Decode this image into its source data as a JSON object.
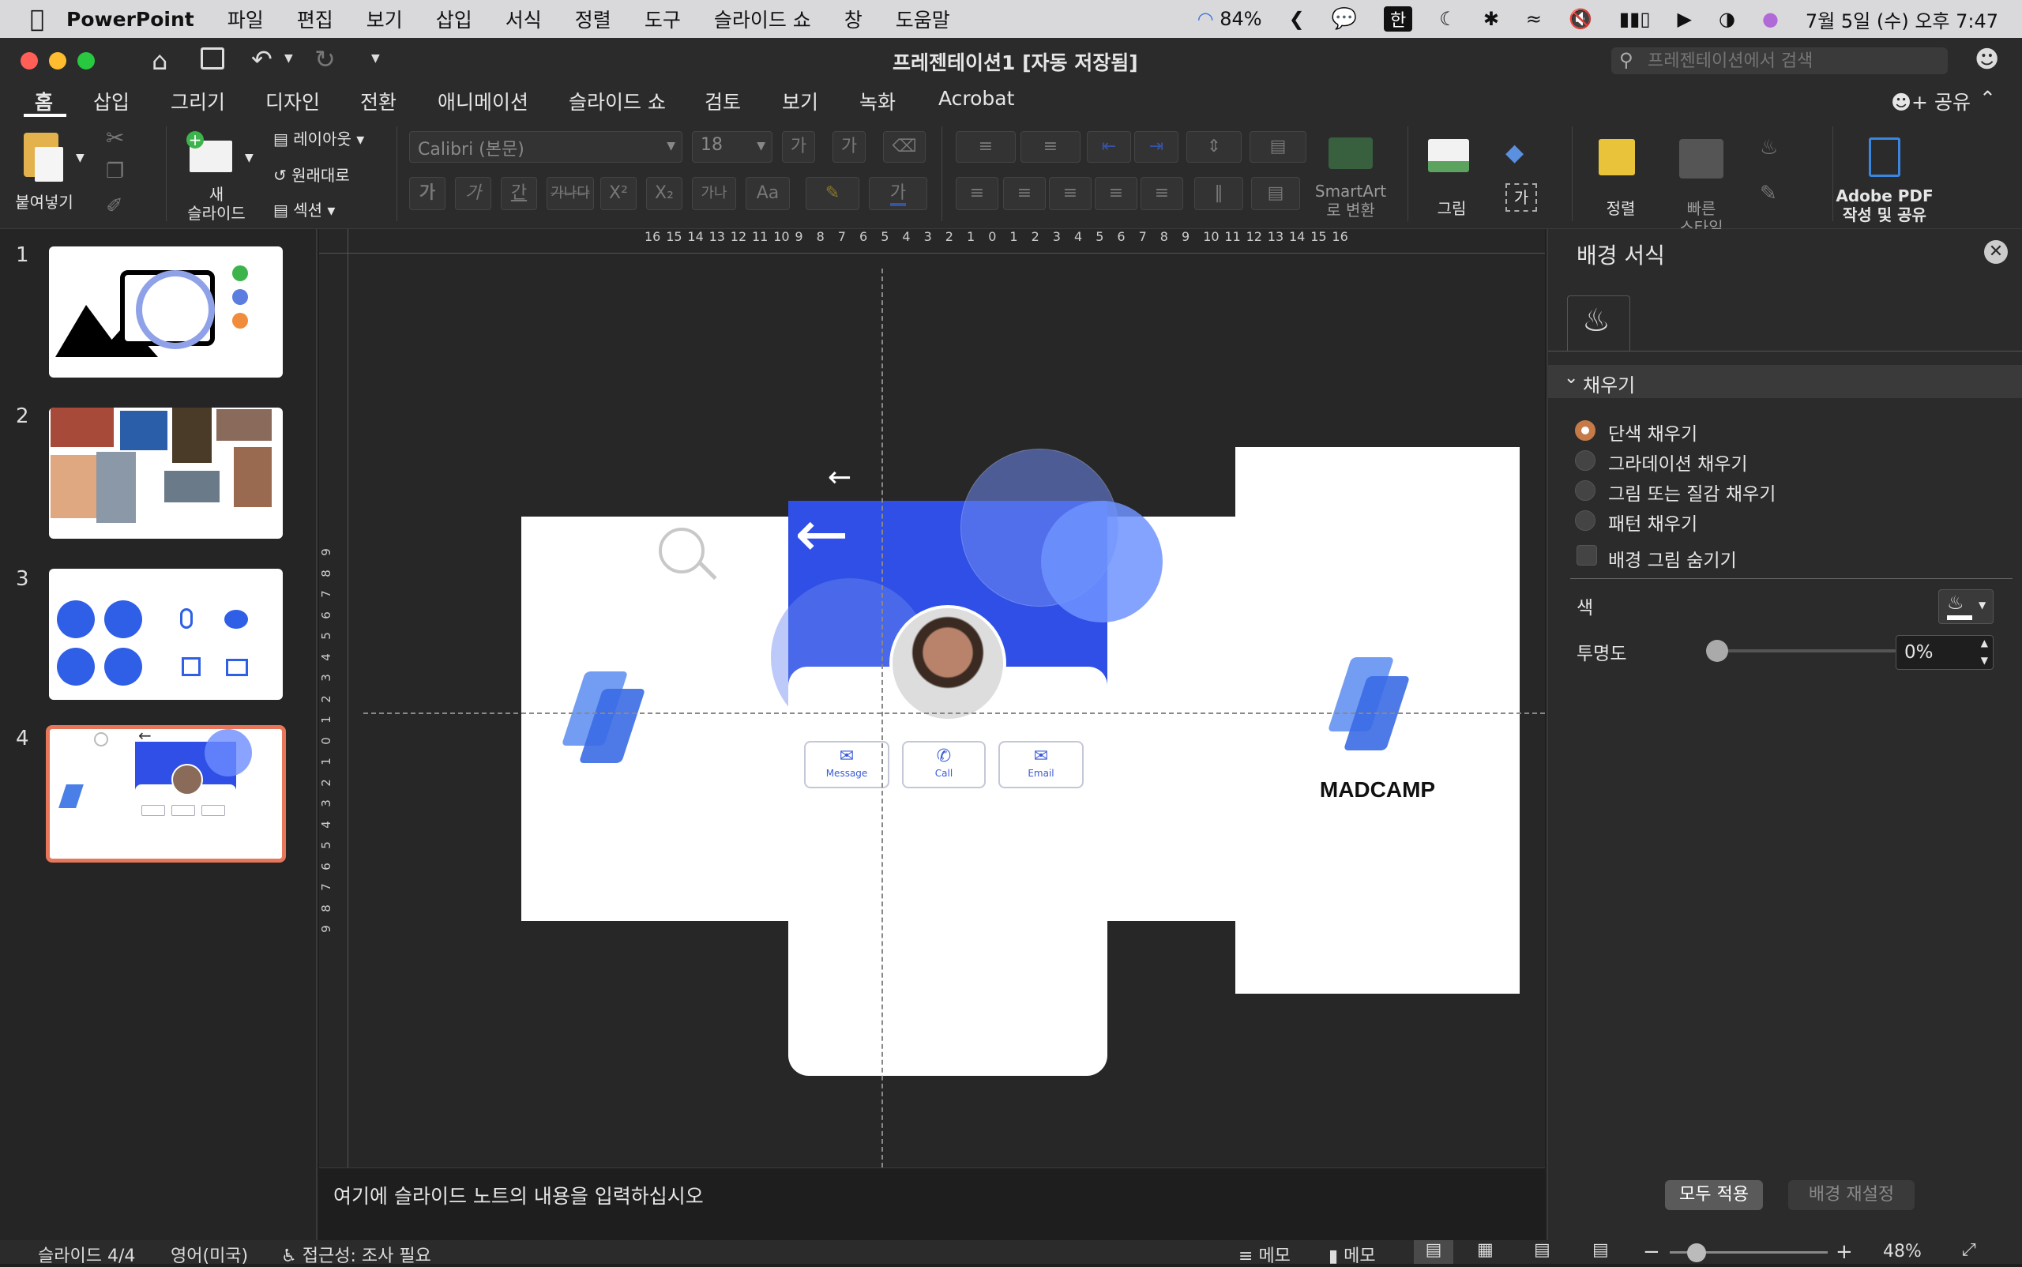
{
  "menubar": {
    "app_name": "PowerPoint",
    "items": [
      "파일",
      "편집",
      "보기",
      "삽입",
      "서식",
      "정렬",
      "도구",
      "슬라이드 쇼",
      "창",
      "도움말"
    ],
    "battery_sync": "84%",
    "input_method": "한",
    "datetime": "7월 5일 (수) 오후 7:47"
  },
  "titlebar": {
    "title": "프레젠테이션1 [자동 저장됨]",
    "search_placeholder": "프레젠테이션에서 검색"
  },
  "tabs": [
    "홈",
    "삽입",
    "그리기",
    "디자인",
    "전환",
    "애니메이션",
    "슬라이드 쇼",
    "검토",
    "보기",
    "녹화",
    "Acrobat"
  ],
  "share_label": "공유",
  "ribbon": {
    "paste": "붙여넣기",
    "new_slide": "새\n슬라이드",
    "layout": "레이아웃",
    "reset": "원래대로",
    "section": "섹션",
    "font_name": "Calibri (본문)",
    "font_size": "18",
    "smartart": "SmartArt\n로 변환",
    "picture": "그림",
    "arrange": "정렬",
    "quick_styles": "빠른\n스타일",
    "adobe": "Adobe PDF\n작성 및 공유"
  },
  "ruler_h": [
    "16",
    "15",
    "14",
    "13",
    "12",
    "11",
    "10",
    "9",
    "8",
    "7",
    "6",
    "5",
    "4",
    "3",
    "2",
    "1",
    "0",
    "1",
    "2",
    "3",
    "4",
    "5",
    "6",
    "7",
    "8",
    "9",
    "10",
    "11",
    "12",
    "13",
    "14",
    "15",
    "16"
  ],
  "ruler_v": [
    "9",
    "8",
    "7",
    "6",
    "5",
    "4",
    "3",
    "2",
    "1",
    "0",
    "1",
    "2",
    "3",
    "4",
    "5",
    "6",
    "7",
    "8",
    "9"
  ],
  "slides": [
    {
      "num": "1"
    },
    {
      "num": "2"
    },
    {
      "num": "3"
    },
    {
      "num": "4"
    }
  ],
  "slide": {
    "buttons": [
      "Message",
      "Call",
      "Email"
    ],
    "brand": "MADCAMP",
    "thumb_buttons": [
      "Message",
      "Call",
      "Email"
    ]
  },
  "notes_placeholder": "여기에 슬라이드 노트의 내용을 입력하십시오",
  "pane": {
    "title": "배경 서식",
    "section": "채우기",
    "options": [
      "단색 채우기",
      "그라데이션 채우기",
      "그림 또는 질감 채우기",
      "패턴 채우기"
    ],
    "hide_bg": "배경 그림 숨기기",
    "color_label": "색",
    "transparency_label": "투명도",
    "transparency_value": "0%",
    "transparency_level": 0,
    "apply_all": "모두 적용",
    "reset_bg": "배경 재설정"
  },
  "status": {
    "slide_count": "슬라이드 4/4",
    "language": "영어(미국)",
    "accessibility": "접근성: 조사 필요",
    "notes": "메모",
    "comments": "메모",
    "zoom": "48%",
    "zoom_level": 0.48
  },
  "colors": {
    "accent": "#2f4fe6",
    "selected": "#e8765a",
    "radio_on": "#c57a47"
  }
}
